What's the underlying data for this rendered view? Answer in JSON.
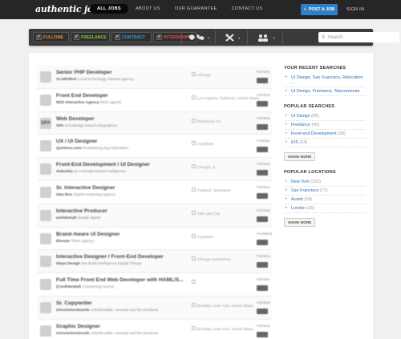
{
  "brand": {
    "logo": "authentic jobs"
  },
  "nav": {
    "items": [
      {
        "label": "ALL JOBS",
        "active": true
      },
      {
        "label": "ABOUT US",
        "active": false
      },
      {
        "label": "OUR GUARANTEE",
        "active": false
      },
      {
        "label": "CONTACT US",
        "active": false
      }
    ],
    "post_label": "POST A JOB",
    "signin_label": "SIGN IN"
  },
  "filters": {
    "chips": [
      {
        "label": "FULLTIME",
        "color": "#e08a3c"
      },
      {
        "label": "FREELANCE",
        "color": "#8cc63f"
      },
      {
        "label": "CONTRACT",
        "color": "#3a9ad9"
      },
      {
        "label": "INTERNSHIP",
        "color": "#e0494b"
      }
    ],
    "icons": [
      "globe-icon",
      "tools-icon",
      "people-icon"
    ],
    "search_placeholder": "Search"
  },
  "jobs": [
    {
      "logo": "",
      "title": "Senior PHP Developer",
      "company": "VLUMSfest",
      "desc": "Local technology Interest agency",
      "location": "Chicago",
      "type": "Full-time",
      "date": ""
    },
    {
      "logo": "",
      "title": "Front End Developer",
      "company": "RED Interactive Agency",
      "desc": "RED agents",
      "location": "Los Angeles, California, United States",
      "type": "Full-time",
      "date": ""
    },
    {
      "logo": "SPA",
      "title": "Web Developer",
      "company": "SPA",
      "desc": "Knowledge-based infographics",
      "location": "Richmond, VA",
      "type": "Full-time",
      "date": ""
    },
    {
      "logo": "",
      "title": "UX / UI Designer",
      "company": "Quintess.com",
      "desc": "Revitalizing Ego Education",
      "location": "Anywhere",
      "type": "Contract",
      "date": ""
    },
    {
      "logo": "",
      "title": "Front-End Development / UI Designer",
      "company": "Suburbia",
      "desc": "an Australia-based intelligence",
      "location": "Chicago, IL",
      "type": "Full-time",
      "date": ""
    },
    {
      "logo": "",
      "title": "Sr. Interactive Designer",
      "company": "Idea Box",
      "desc": "Digital marketing agency",
      "location": "Portland, Tennessee",
      "type": "Full-time",
      "date": ""
    },
    {
      "logo": "",
      "title": "Interactive Producer",
      "company": "worldsmall",
      "desc": "Seattle digital",
      "location": "Salt Lake City",
      "type": "Full-time",
      "date": ""
    },
    {
      "logo": "",
      "title": "Brand-Aware UI Designer",
      "company": "Elevate",
      "desc": "Think Agency",
      "location": "Anywhere",
      "type": "Freelance",
      "date": ""
    },
    {
      "logo": "",
      "title": "Interactive Designer / Front-End Developer",
      "company": "Wayo Design",
      "desc": "We Build intelligence Digital Things",
      "location": "Chicago everywhere",
      "type": "Full-time",
      "date": ""
    },
    {
      "logo": "",
      "title": "Full Time Front End Web Developer with HAML/S...",
      "company": "(Confidential)",
      "desc": "Connecting source",
      "location": "",
      "type": "Full-time",
      "date": ""
    },
    {
      "logo": "",
      "title": "Sr. Copywriter",
      "company": "UncommonGoods",
      "desc": "Unbelievable, unusual and fun products",
      "location": "Brooklyn, New York, United States",
      "type": "Full-time",
      "date": ""
    },
    {
      "logo": "",
      "title": "Graphic Designer",
      "company": "UncommonGoods",
      "desc": "Unbelievable, unusual and fun products",
      "location": "Brooklyn, New York, United States",
      "type": "Full-time",
      "date": ""
    }
  ],
  "sidebar": {
    "recent": {
      "title": "YOUR RECENT SEARCHES",
      "items": [
        {
          "label": "UI Design, San Francisco, Relocation ..."
        },
        {
          "label": "UI Design, Freelance, Telecommute"
        }
      ]
    },
    "popular_searches": {
      "title": "POPULAR SEARCHES",
      "items": [
        {
          "label": "UI Design",
          "count": "(55)"
        },
        {
          "label": "Freelance",
          "count": "(45)"
        },
        {
          "label": "Front-end Development",
          "count": "(38)"
        },
        {
          "label": "iOS",
          "count": "(24)"
        }
      ],
      "more": "SHOW MORE"
    },
    "popular_locations": {
      "title": "POPULAR LOCATIONS",
      "items": [
        {
          "label": "New York",
          "count": "(102)"
        },
        {
          "label": "San Francisco",
          "count": "(71)"
        },
        {
          "label": "Austin",
          "count": "(18)"
        },
        {
          "label": "London",
          "count": "(16)"
        }
      ],
      "more": "SHOW MORE"
    }
  }
}
